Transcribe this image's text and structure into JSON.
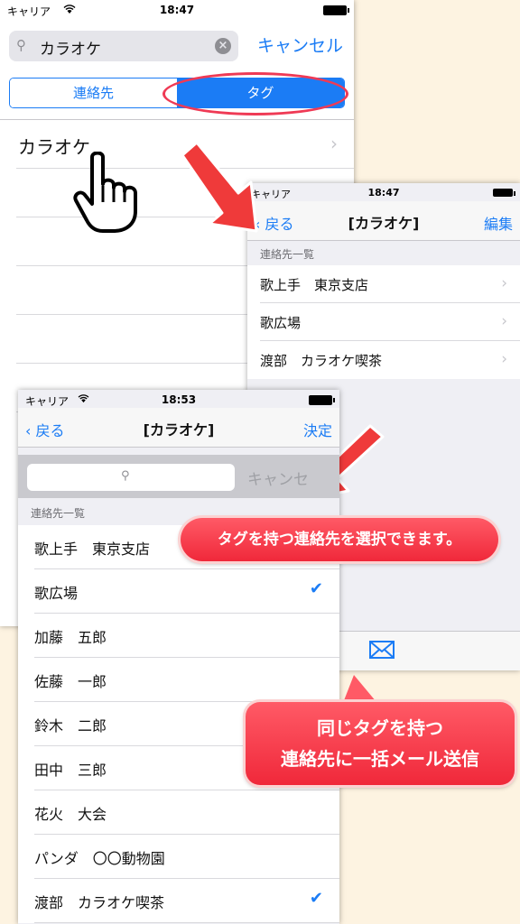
{
  "screen1": {
    "status": {
      "carrier": "キャリア",
      "time": "18:47"
    },
    "search_query": "カラオケ",
    "cancel_label": "キャンセル",
    "segments": [
      "連絡先",
      "タグ"
    ],
    "rows": [
      "カラオケ"
    ]
  },
  "screen2": {
    "status": {
      "carrier": "キャリア",
      "time": "18:47"
    },
    "nav": {
      "back": "戻る",
      "title": "[カラオケ]",
      "right": "編集"
    },
    "section_header": "連絡先一覧",
    "contacts": [
      "歌上手　東京支店",
      "歌広場",
      "渡部　カラオケ喫茶"
    ],
    "toolbar_icon": "envelope-icon"
  },
  "screen3": {
    "status": {
      "carrier": "キャリア",
      "time": "18:53"
    },
    "nav": {
      "back": "戻る",
      "title": "[カラオケ]",
      "right": "決定"
    },
    "search_cancel": "キャンセ",
    "section_header": "連絡先一覧",
    "contacts": [
      {
        "name": "歌上手　東京支店",
        "checked": false
      },
      {
        "name": "歌広場",
        "checked": true
      },
      {
        "name": "加藤　五郎",
        "checked": false
      },
      {
        "name": "佐藤　一郎",
        "checked": false
      },
      {
        "name": "鈴木　二郎",
        "checked": false
      },
      {
        "name": "田中　三郎",
        "checked": false
      },
      {
        "name": "花火　大会",
        "checked": false
      },
      {
        "name": "パンダ　〇〇動物園",
        "checked": false
      },
      {
        "name": "渡部　カラオケ喫茶",
        "checked": true
      }
    ]
  },
  "callouts": {
    "select": "タグを持つ連絡先を選択できます。",
    "mail_line1": "同じタグを持つ",
    "mail_line2": "連絡先に一括メール送信"
  },
  "colors": {
    "accent": "#1b7cf5",
    "callout": "#f0283a",
    "background": "#fdf3e1"
  }
}
